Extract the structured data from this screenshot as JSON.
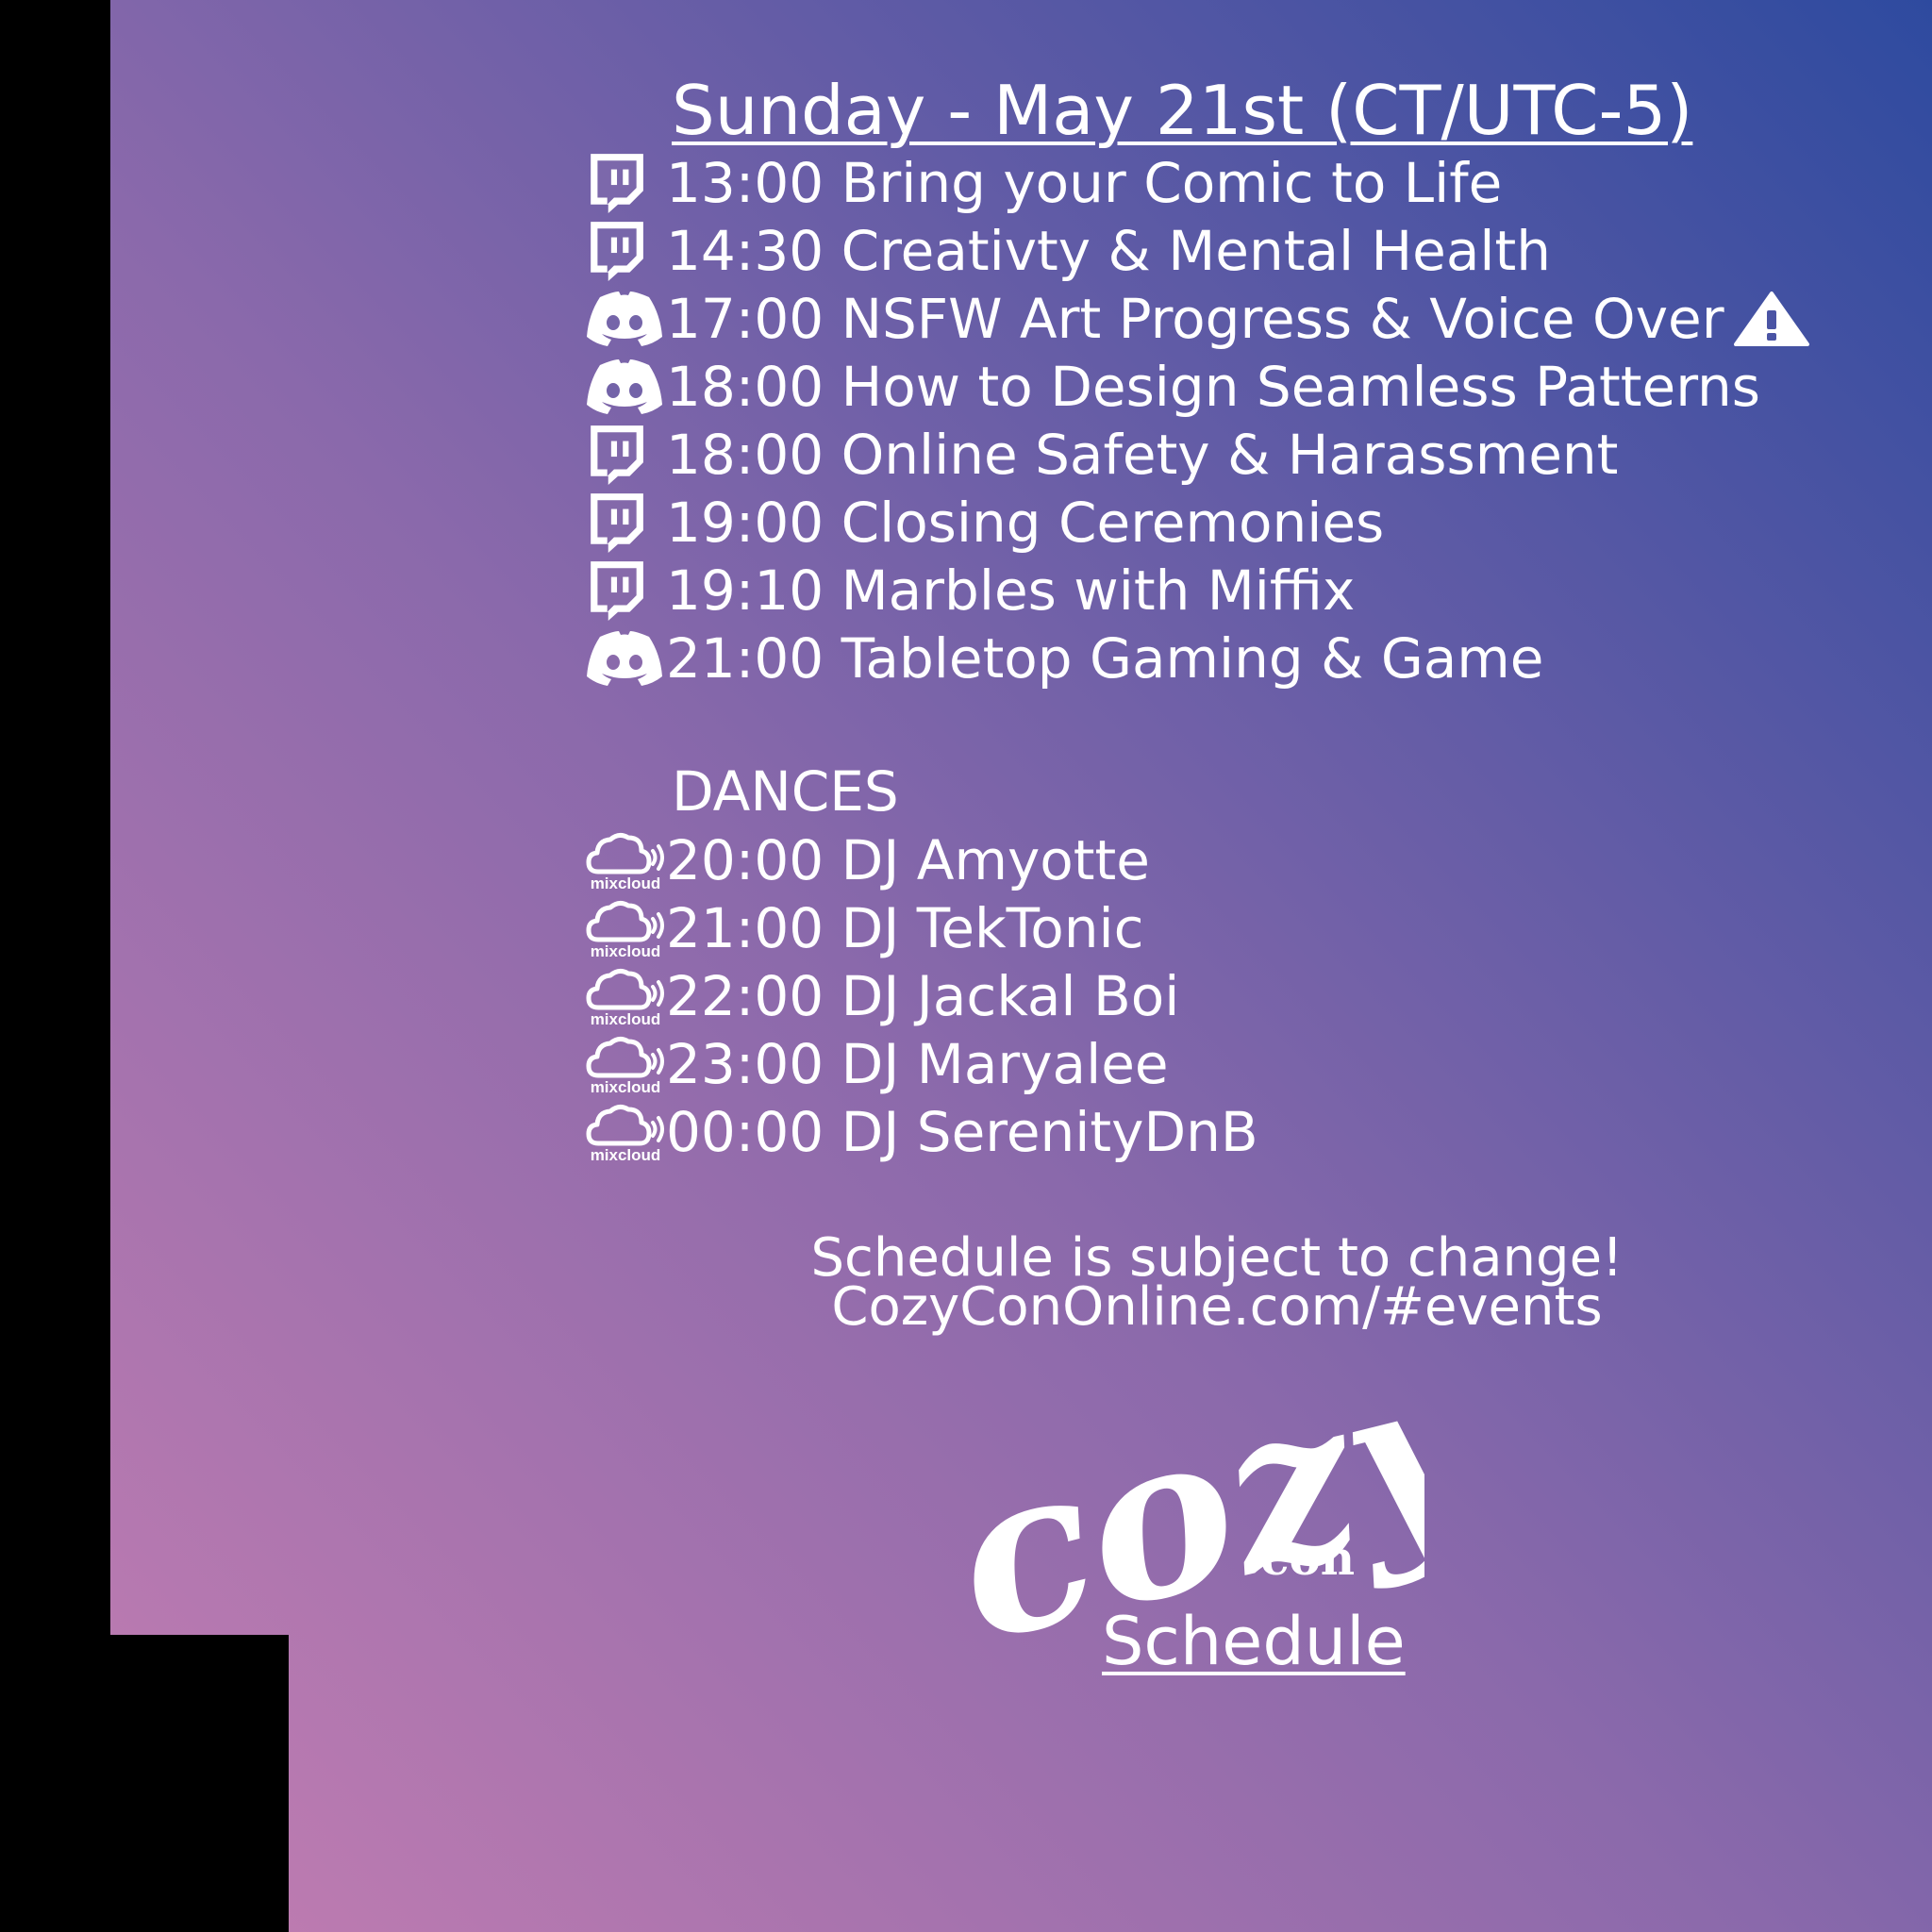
{
  "colors": {
    "gradient_bottom_left": "#c27db1",
    "gradient_middle": "#8a69ab",
    "gradient_top_right": "#2d4a9f",
    "text": "#ffffff",
    "frame": "#000000"
  },
  "header": {
    "title": "Sunday - May 21st (CT/UTC-5)"
  },
  "events": [
    {
      "platform_icon": "twitch-icon",
      "text": "13:00 Bring your Comic to Life"
    },
    {
      "platform_icon": "twitch-icon",
      "text": "14:30 Creativty & Mental Health"
    },
    {
      "platform_icon": "discord-icon",
      "text": "17:00 NSFW Art Progress & Voice Over",
      "badge_icon": "warning-icon"
    },
    {
      "platform_icon": "discord-icon",
      "text": "18:00 How to Design Seamless Patterns"
    },
    {
      "platform_icon": "twitch-icon",
      "text": "18:00 Online Safety & Harassment"
    },
    {
      "platform_icon": "twitch-icon",
      "text": "19:00 Closing Ceremonies"
    },
    {
      "platform_icon": "twitch-icon",
      "text": "19:10 Marbles with Miffix"
    },
    {
      "platform_icon": "discord-icon",
      "text": "21:00 Tabletop Gaming & Game"
    }
  ],
  "dances": {
    "heading": "DANCES",
    "icon_label": "mixcloud",
    "items": [
      {
        "platform_icon": "mixcloud-icon",
        "text": "20:00 DJ Amyotte"
      },
      {
        "platform_icon": "mixcloud-icon",
        "text": "21:00 DJ TekTonic"
      },
      {
        "platform_icon": "mixcloud-icon",
        "text": "22:00 DJ Jackal Boi"
      },
      {
        "platform_icon": "mixcloud-icon",
        "text": "23:00 DJ Maryalee"
      },
      {
        "platform_icon": "mixcloud-icon",
        "text": "00:00 DJ SerenityDnB"
      }
    ]
  },
  "footer": {
    "notice": "Schedule is subject to change!",
    "url": "CozyConOnline.com/#events"
  },
  "logo": {
    "wordmark": "cozy",
    "subword": "con",
    "caption": "Schedule"
  }
}
